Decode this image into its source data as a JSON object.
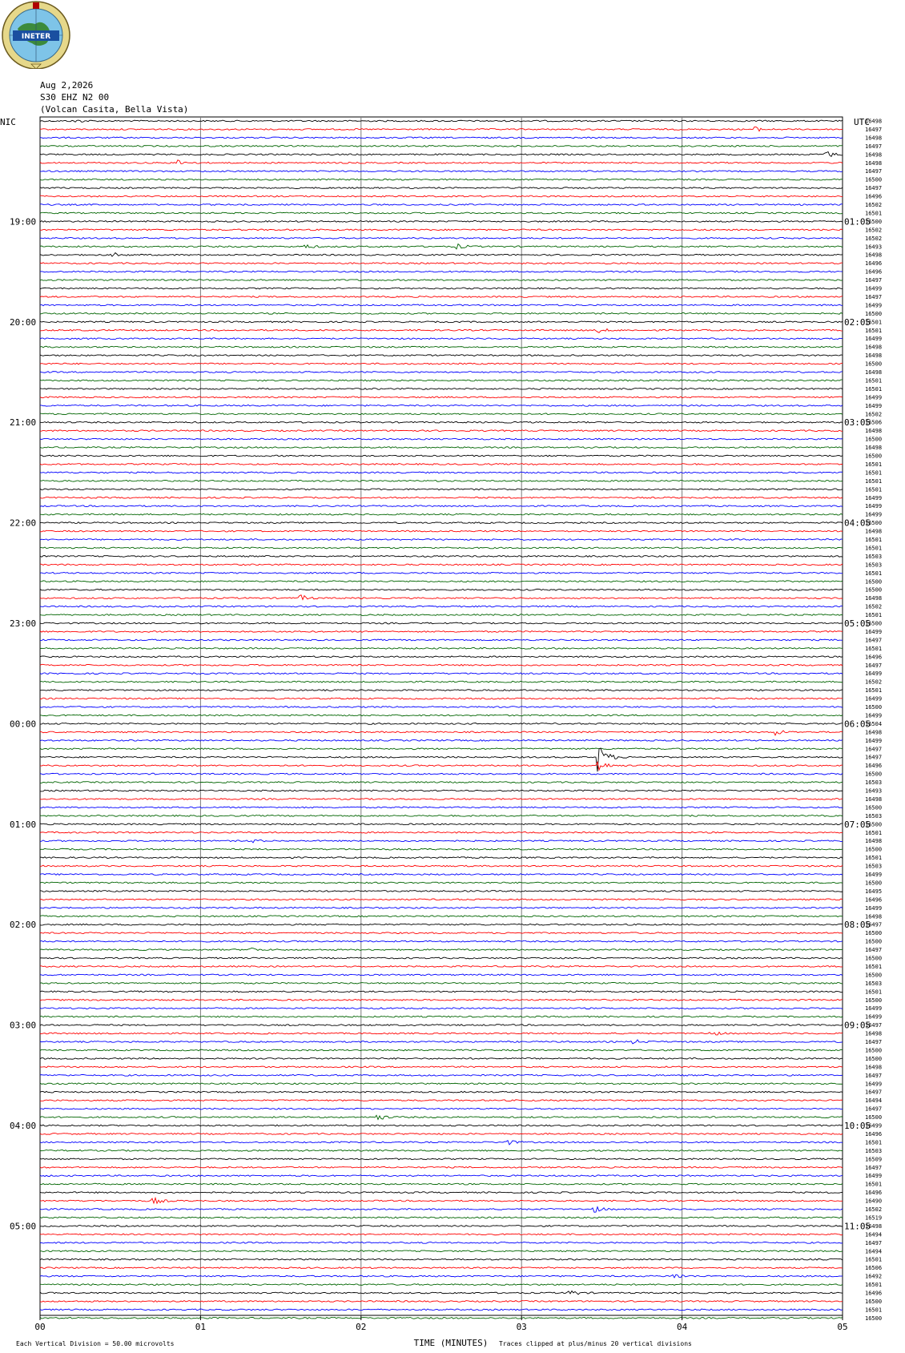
{
  "header": {
    "logo_text": "INETER",
    "date": "Aug 2,2026",
    "station": "S30 EHZ N2 00",
    "location": "(Volcan Casita, Bella Vista)"
  },
  "colors": {
    "trace_cycle": [
      "#000000",
      "#ff0000",
      "#0000ff",
      "#006400"
    ],
    "grid": "#7a7a7a"
  },
  "chart_data": {
    "type": "line",
    "left_zone": "NIC",
    "right_zone": "UTC",
    "xlabel": "TIME (MINUTES)",
    "x_ticks": [
      "00",
      "01",
      "02",
      "03",
      "04",
      "05"
    ],
    "xlim": [
      0,
      5
    ],
    "trace_minutes": 5,
    "left_hour_labels": [
      "19:00",
      "20:00",
      "21:00",
      "22:00",
      "23:00",
      "00:00",
      "01:00",
      "02:00",
      "03:00",
      "04:00",
      "05:00"
    ],
    "right_hour_labels": [
      "01:05",
      "02:05",
      "03:05",
      "04:05",
      "05:05",
      "06:05",
      "07:05",
      "08:05",
      "09:05",
      "10:05",
      "11:05"
    ],
    "row_counts": [
      16498,
      16497,
      16498,
      16497,
      16498,
      16498,
      16497,
      16500,
      16497,
      16496,
      16502,
      16501,
      16500,
      16502,
      16502,
      16493,
      16498,
      16496,
      16496,
      16497,
      16499,
      16497,
      16499,
      16500,
      16501,
      16501,
      16499,
      16498,
      16498,
      16500,
      16498,
      16501,
      16501,
      16499,
      16499,
      16502,
      16506,
      16498,
      16500,
      16498,
      16500,
      16501,
      16501,
      16501,
      16501,
      16499,
      16499,
      16499,
      16500,
      16498,
      16501,
      16501,
      16503,
      16503,
      16501,
      16500,
      16500,
      16498,
      16502,
      16501,
      16500,
      16499,
      16497,
      16501,
      16496,
      16497,
      16499,
      16502,
      16501,
      16499,
      16500,
      16499,
      16504,
      16498,
      16499,
      16497,
      16497,
      16496,
      16500,
      16503,
      16493,
      16498,
      16500,
      16503,
      16500,
      16501,
      16498,
      16500,
      16501,
      16503,
      16499,
      16500,
      16495,
      16496,
      16499,
      16498,
      16497,
      16500,
      16500,
      16497,
      16500,
      16501,
      16500,
      16503,
      16501,
      16500,
      16499,
      16499,
      16497,
      16498,
      16497,
      16500,
      16500,
      16498,
      16497,
      16499,
      16497,
      16494,
      16497,
      16500,
      16499,
      16496,
      16501,
      16503,
      16509,
      16497,
      16499,
      16501,
      16496,
      16490,
      16502,
      16519,
      16498,
      16494,
      16497,
      16494,
      16501,
      16506,
      16492,
      16501,
      16496,
      16500,
      16501,
      16500
    ],
    "events": [
      {
        "row": 0,
        "minute": 0.22,
        "amp": 2
      },
      {
        "row": 1,
        "minute": 4.45,
        "amp": 3
      },
      {
        "row": 4,
        "minute": 4.9,
        "amp": 4
      },
      {
        "row": 5,
        "minute": 0.85,
        "amp": 4
      },
      {
        "row": 15,
        "minute": 1.65,
        "amp": 3
      },
      {
        "row": 15,
        "minute": 2.6,
        "amp": 3
      },
      {
        "row": 16,
        "minute": 0.45,
        "amp": 3
      },
      {
        "row": 25,
        "minute": 3.48,
        "amp": 3
      },
      {
        "row": 57,
        "minute": 1.62,
        "amp": 4
      },
      {
        "row": 73,
        "minute": 4.58,
        "amp": 4
      },
      {
        "row": 76,
        "minute": 3.48,
        "amp": 18
      },
      {
        "row": 77,
        "minute": 3.48,
        "amp": 7
      },
      {
        "row": 86,
        "minute": 1.3,
        "amp": 3
      },
      {
        "row": 99,
        "minute": 1.3,
        "amp": 3
      },
      {
        "row": 109,
        "minute": 4.18,
        "amp": 3
      },
      {
        "row": 110,
        "minute": 3.7,
        "amp": 3
      },
      {
        "row": 119,
        "minute": 2.1,
        "amp": 4
      },
      {
        "row": 122,
        "minute": 2.9,
        "amp": 4
      },
      {
        "row": 129,
        "minute": 0.7,
        "amp": 5
      },
      {
        "row": 130,
        "minute": 3.45,
        "amp": 4
      },
      {
        "row": 138,
        "minute": 3.95,
        "amp": 4
      },
      {
        "row": 140,
        "minute": 3.3,
        "amp": 4
      }
    ],
    "footer_left": "Each Vertical Division =   50.00 microvolts",
    "footer_right": "Traces clipped at plus/minus 20 vertical divisions"
  }
}
